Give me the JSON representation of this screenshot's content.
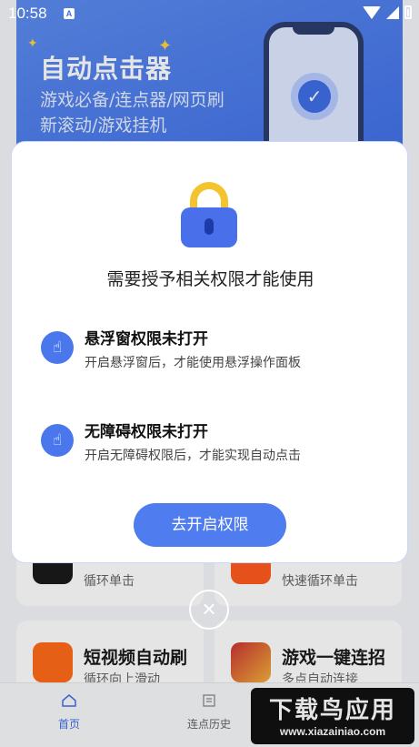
{
  "status_bar": {
    "time": "10:58",
    "notification_icon": "A"
  },
  "banner": {
    "title": "自动点击器",
    "subtitle_line1": "游戏必备/连点器/网页刷",
    "subtitle_line2": "新滚动/游戏挂机"
  },
  "cards": [
    {
      "desc": "循环单击"
    },
    {
      "desc": "快速循环单击"
    },
    {
      "title": "短视频自动刷",
      "desc": "循环向上滑动"
    },
    {
      "title": "游戏一键连招",
      "desc": "多点自动连接"
    }
  ],
  "tab_bar": {
    "home_label": "首页",
    "history_label": "连点历史"
  },
  "watermark": {
    "big": "下载鸟应用",
    "url": "www.xiazainiao.com"
  },
  "dialog": {
    "title": "需要授予相关权限才能使用",
    "permissions": [
      {
        "title": "悬浮窗权限未打开",
        "desc": "开启悬浮窗后，才能使用悬浮操作面板"
      },
      {
        "title": "无障碍权限未打开",
        "desc": "开启无障碍权限后，才能实现自动点击"
      }
    ],
    "button_label": "去开启权限"
  },
  "colors": {
    "accent": "#4f7cee",
    "lock_shackle": "#f4c430",
    "lock_body": "#4a6fea"
  }
}
